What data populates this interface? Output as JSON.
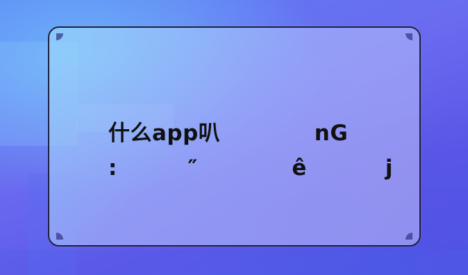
{
  "card": {
    "title_line1": "什么app叭            nG",
    "title_line2": ":         ″            ê          j"
  }
}
